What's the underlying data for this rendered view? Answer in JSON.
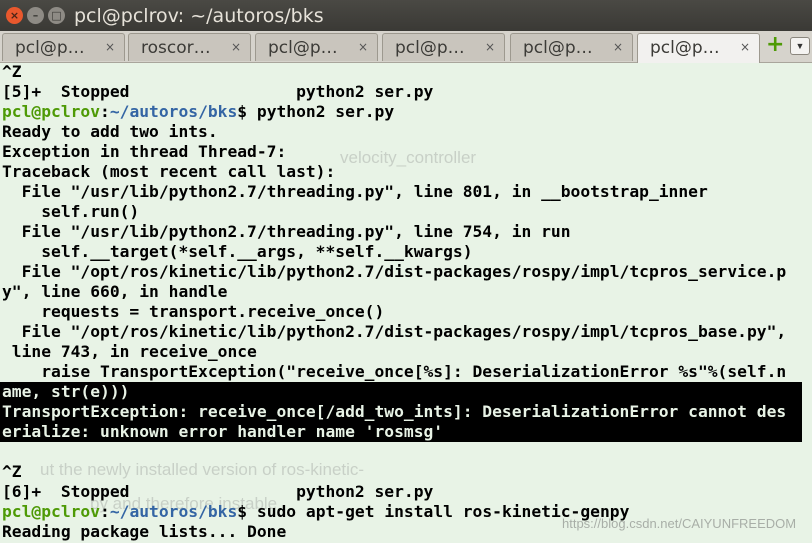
{
  "window": {
    "title": "pcl@pclrov: ~/autoros/bks",
    "close_glyph": "×",
    "minimize_glyph": "–",
    "maximize_glyph": "□"
  },
  "tabs": [
    {
      "label": "pcl@p…",
      "close": "×",
      "active": false
    },
    {
      "label": "roscor…",
      "close": "×",
      "active": false
    },
    {
      "label": "pcl@p…",
      "close": "×",
      "active": false
    },
    {
      "label": "pcl@p…",
      "close": "×",
      "active": false
    },
    {
      "label": "pcl@p…",
      "close": "×",
      "active": false
    },
    {
      "label": "pcl@p…",
      "close": "×",
      "active": true
    }
  ],
  "tabbar": {
    "add_glyph": "+",
    "menu_glyph": "▼"
  },
  "terminal": {
    "lines": [
      "^Z",
      "[5]+  Stopped                 python2 ser.py",
      "",
      "Ready to add two ints.",
      "Exception in thread Thread-7:",
      "Traceback (most recent call last):",
      "  File \"/usr/lib/python2.7/threading.py\", line 801, in __bootstrap_inner",
      "    self.run()",
      "  File \"/usr/lib/python2.7/threading.py\", line 754, in run",
      "    self.__target(*self.__args, **self.__kwargs)",
      "  File \"/opt/ros/kinetic/lib/python2.7/dist-packages/rospy/impl/tcpros_service.p",
      "y\", line 660, in handle",
      "    requests = transport.receive_once()",
      "  File \"/opt/ros/kinetic/lib/python2.7/dist-packages/rospy/impl/tcpros_base.py\",",
      " line 743, in receive_once",
      "    raise TransportException(\"receive_once[%s]: DeserializationError %s\"%(self.n",
      "ame, str(e)))",
      "TransportException: receive_once[/add_two_ints]: DeserializationError cannot des",
      "erialize: unknown error handler name 'rosmsg'",
      "",
      "^Z",
      "[6]+  Stopped                 python2 ser.py",
      "",
      "Reading package lists... Done"
    ],
    "prompt_user": "pcl@pclrov",
    "prompt_sep": ":",
    "prompt_path": "~/autoros/bks",
    "prompt_end": "$ ",
    "cmd1": "python2 ser.py",
    "cmd2": "sudo apt-get install ros-kinetic-genpy"
  },
  "watermarks": {
    "bg1": "velocity_controller",
    "bg2": "ut the newly installed version of ros-kinetic-",
    "bg3": "py and therefore                    instable",
    "url": "https://blog.csdn.net/CAIYUNFREEDOM"
  }
}
